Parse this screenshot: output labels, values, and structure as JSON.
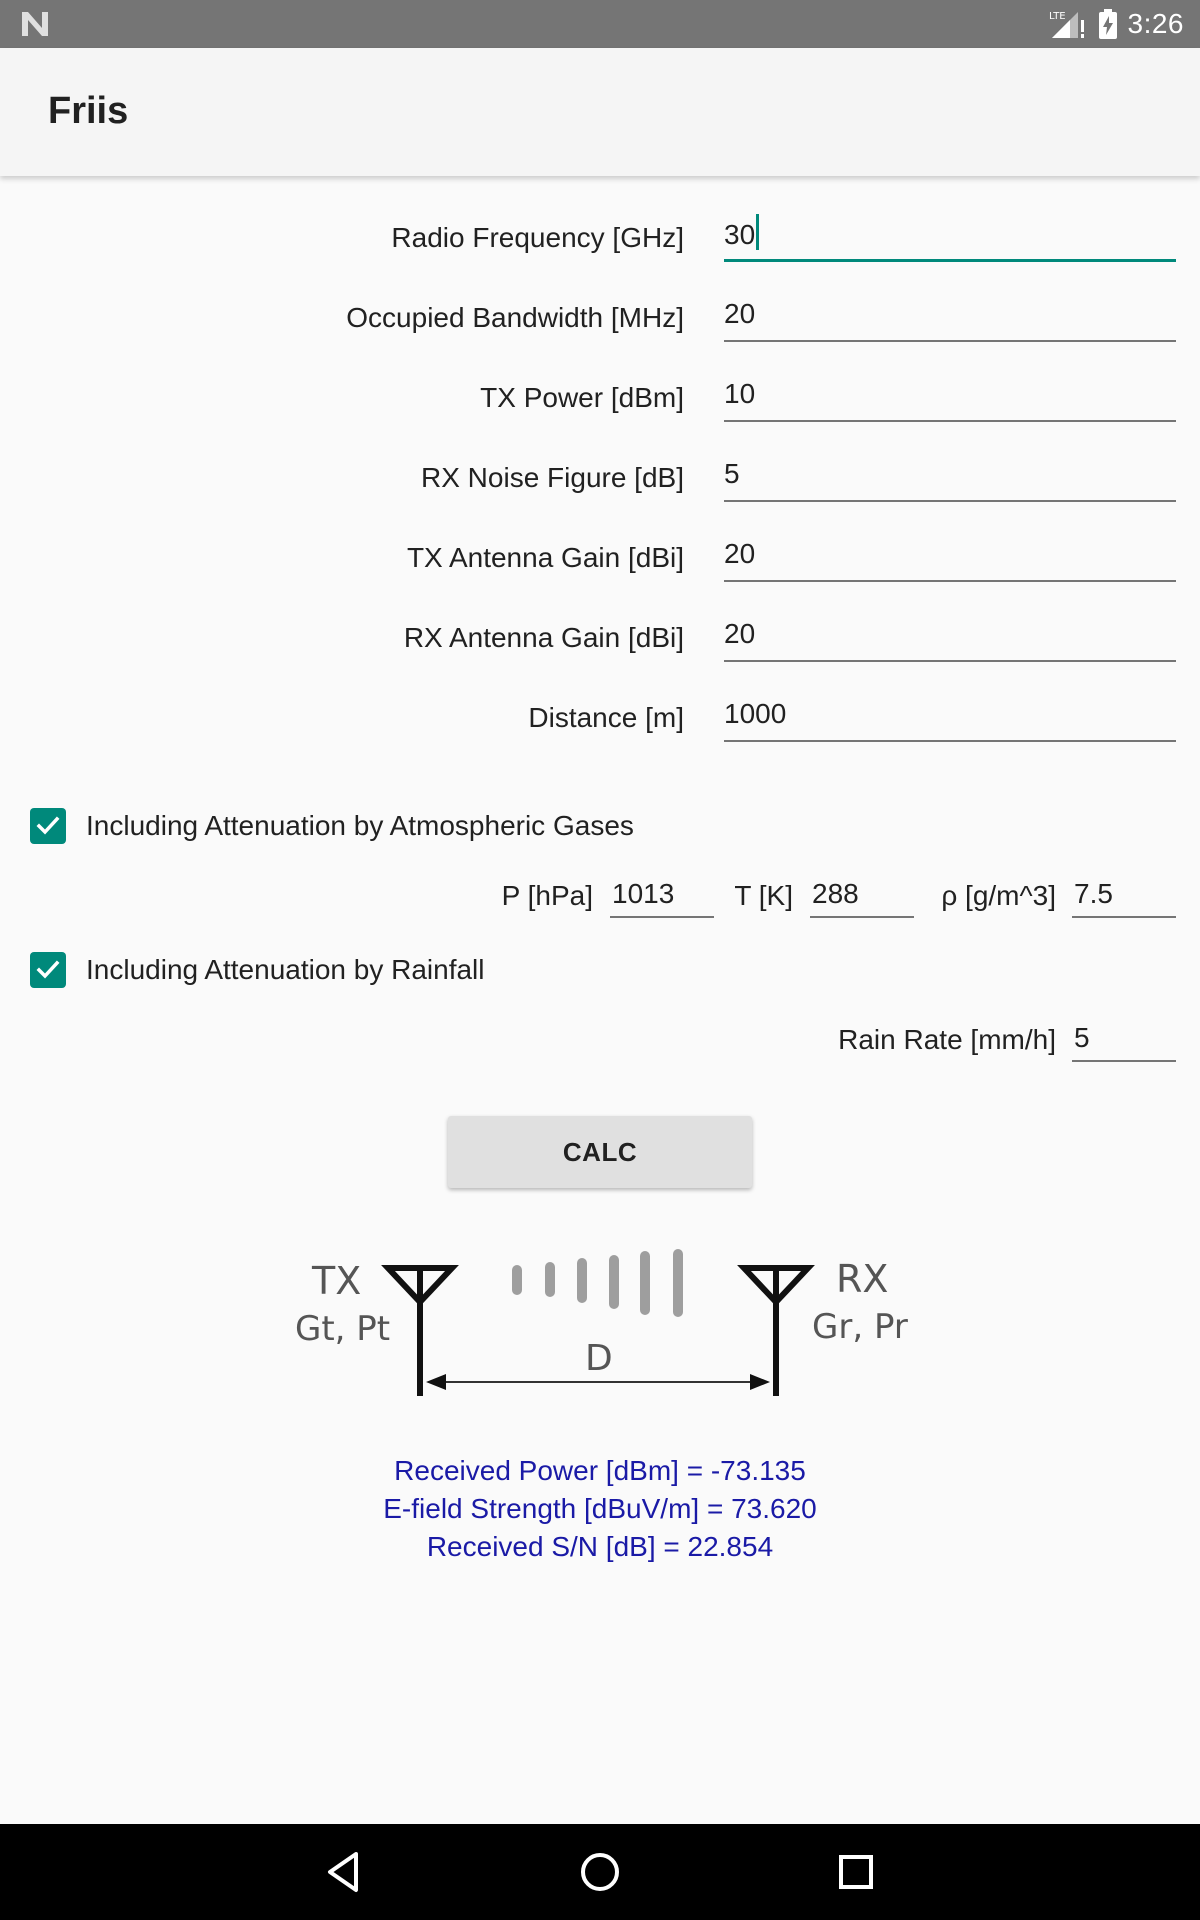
{
  "status_bar": {
    "time": "3:26",
    "network": "LTE"
  },
  "app_bar": {
    "title": "Friis"
  },
  "form": {
    "fields": [
      {
        "label": "Radio Frequency [GHz]",
        "value": "30"
      },
      {
        "label": "Occupied Bandwidth [MHz]",
        "value": "20"
      },
      {
        "label": "TX Power [dBm]",
        "value": "10"
      },
      {
        "label": "RX Noise Figure [dB]",
        "value": "5"
      },
      {
        "label": "TX Antenna Gain [dBi]",
        "value": "20"
      },
      {
        "label": "RX Antenna Gain [dBi]",
        "value": "20"
      },
      {
        "label": "Distance [m]",
        "value": "1000"
      }
    ]
  },
  "atmospheric": {
    "checkbox_label": "Including Attenuation by Atmospheric Gases",
    "checked": true,
    "pressure_label": "P [hPa]",
    "pressure_value": "1013",
    "temperature_label": "T [K]",
    "temperature_value": "288",
    "density_label": "ρ [g/m^3]",
    "density_value": "7.5"
  },
  "rainfall": {
    "checkbox_label": "Including Attenuation by Rainfall",
    "checked": true,
    "rain_rate_label": "Rain Rate [mm/h]",
    "rain_rate_value": "5"
  },
  "calc_button": {
    "label": "CALC"
  },
  "diagram": {
    "tx_label": "TX",
    "tx_params": "Gt, Pt",
    "rx_label": "RX",
    "rx_params": "Gr, Pr",
    "distance_label": "D"
  },
  "results": {
    "received_power": "Received Power [dBm] = -73.135",
    "efield_strength": "E-field Strength [dBuV/m] = 73.620",
    "signal_noise": "Received S/N [dB] = 22.854"
  },
  "colors": {
    "accent": "#00897b",
    "result_text": "#1a1aa6",
    "status_bar": "#757575",
    "nav_bar": "#000000"
  },
  "icons": {
    "status_left": "n-logo-icon",
    "status_right": [
      "lte-signal-icon",
      "battery-charging-icon"
    ],
    "nav": [
      "back-icon",
      "home-icon",
      "recents-icon"
    ]
  }
}
